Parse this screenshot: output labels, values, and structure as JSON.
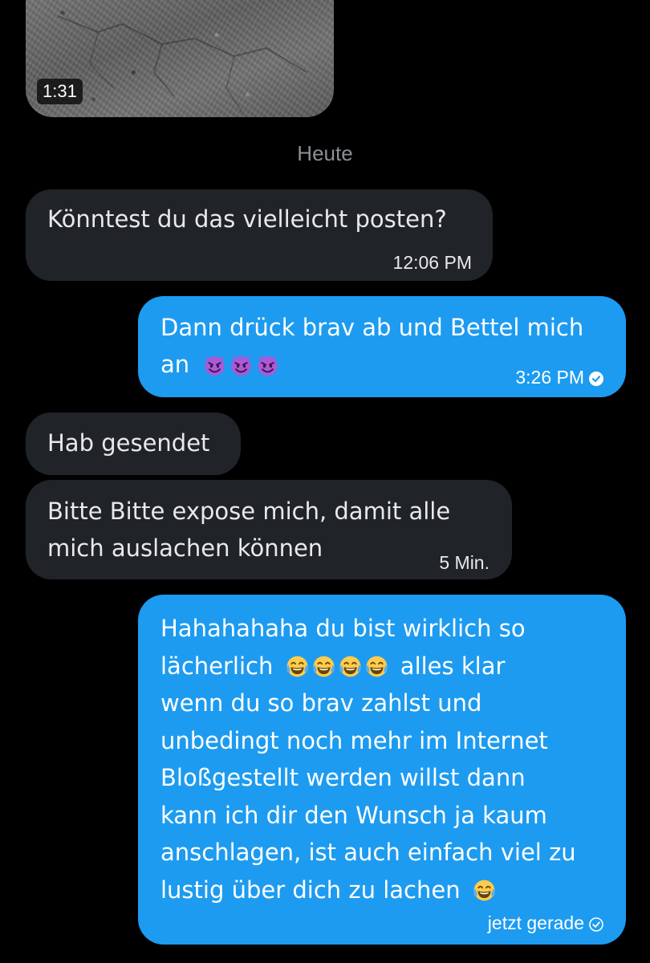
{
  "video": {
    "duration": "1:31"
  },
  "date_separator": "Heute",
  "messages": [
    {
      "text": "Könntest du das vielleicht posten?",
      "time": "12:06 PM"
    },
    {
      "text": "Dann drück brav ab und Bettel mich",
      "text2": "an",
      "emoji": [
        "smiling-imp",
        "smiling-imp",
        "smiling-imp"
      ],
      "time": "3:26 PM",
      "status": "read"
    },
    {
      "text": "Hab gesendet"
    },
    {
      "text": "Bitte Bitte expose mich, damit alle",
      "text2": "mich auslachen können",
      "time": "5 Min."
    },
    {
      "lines": [
        "Hahahahaha du bist wirklich so",
        "lächerlich",
        "alles klar",
        "wenn du so brav zahlst und",
        "unbedingt noch mehr im Internet",
        "Bloßgestellt werden willst dann",
        "kann ich dir den Wunsch ja kaum",
        "anschlagen, ist auch einfach viel zu",
        "lustig über dich zu lachen"
      ],
      "emoji": [
        "tears-of-joy",
        "tears-of-joy",
        "tears-of-joy",
        "tears-of-joy",
        "tears-of-joy"
      ],
      "time": "jetzt gerade",
      "status": "sent"
    }
  ],
  "colors": {
    "background": "#000000",
    "incoming_bubble": "#202327",
    "outgoing_bubble": "#1d9bf0",
    "muted_text": "#8b8f94"
  }
}
